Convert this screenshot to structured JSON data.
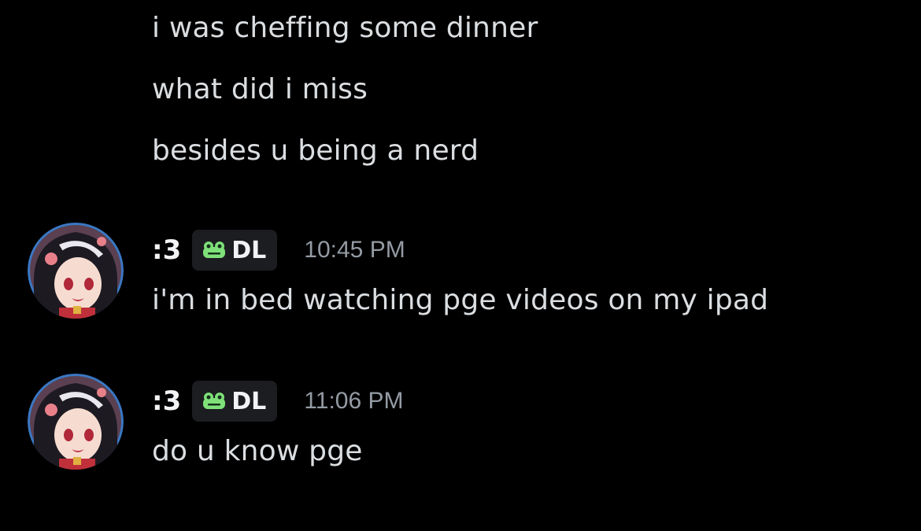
{
  "continued_messages": [
    "i was cheffing some dinner",
    "what did i miss",
    "besides u being a nerd"
  ],
  "messages": [
    {
      "author": ":3",
      "tag": "DL",
      "tag_icon": "frog-icon",
      "timestamp": "10:45 PM",
      "text": "i'm in bed watching pge videos on my ipad"
    },
    {
      "author": ":3",
      "tag": "DL",
      "tag_icon": "frog-icon",
      "timestamp": "11:06 PM",
      "text": "do u know pge"
    }
  ],
  "colors": {
    "background": "#000000",
    "message_text": "#dbdee1",
    "username": "#f2f3f5",
    "timestamp": "#949ba4",
    "tag_background": "#1c1d20",
    "tag_icon": "#7fe07a"
  }
}
